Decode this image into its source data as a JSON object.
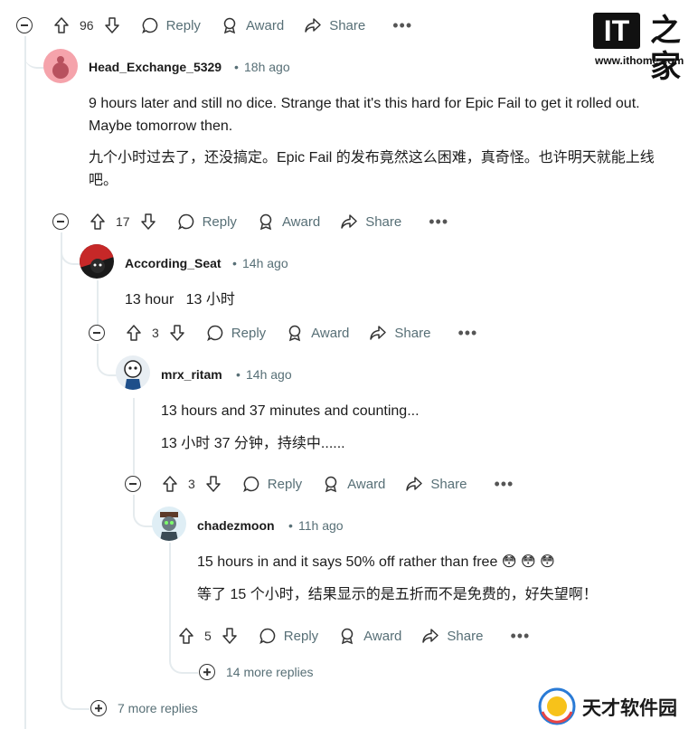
{
  "watermark": {
    "logo_text": "IT之家",
    "url": "www.ithome.com",
    "bottom_brand": "天才软件园"
  },
  "top_actions": {
    "votes": "96",
    "reply": "Reply",
    "award": "Award",
    "share": "Share"
  },
  "comment1": {
    "author": "Head_Exchange_5329",
    "time": "18h ago",
    "text_en": "9 hours later and still no dice. Strange that it's this hard for Epic Fail to get it rolled out. Maybe tomorrow then.",
    "text_zh": "九个小时过去了，还没搞定。Epic Fail 的发布竟然这么困难，真奇怪。也许明天就能上线吧。",
    "votes": "17",
    "reply": "Reply",
    "award": "Award",
    "share": "Share"
  },
  "comment2": {
    "author": "According_Seat",
    "time": "14h ago",
    "text": "13 hour   13 小时",
    "votes": "3",
    "reply": "Reply",
    "award": "Award",
    "share": "Share"
  },
  "comment3": {
    "author": "mrx_ritam",
    "time": "14h ago",
    "text_en": "13 hours and 37 minutes and counting...",
    "text_zh": "13 小时 37 分钟，持续中......",
    "votes": "3",
    "reply": "Reply",
    "award": "Award",
    "share": "Share"
  },
  "comment4": {
    "author": "chadezmoon",
    "time": "11h ago",
    "text_en": "15 hours in and it says 50% off rather than free 😳 😳 😳",
    "text_zh": "等了 15 个小时，结果显示的是五折而不是免费的，好失望啊！",
    "votes": "5",
    "reply": "Reply",
    "award": "Award",
    "share": "Share"
  },
  "more_replies_inner": "14 more replies",
  "more_replies_outer": "7 more replies",
  "separator": "•",
  "colors": {
    "muted": "#576f76",
    "thread": "#e5ebee",
    "text": "#1c1c1c"
  }
}
